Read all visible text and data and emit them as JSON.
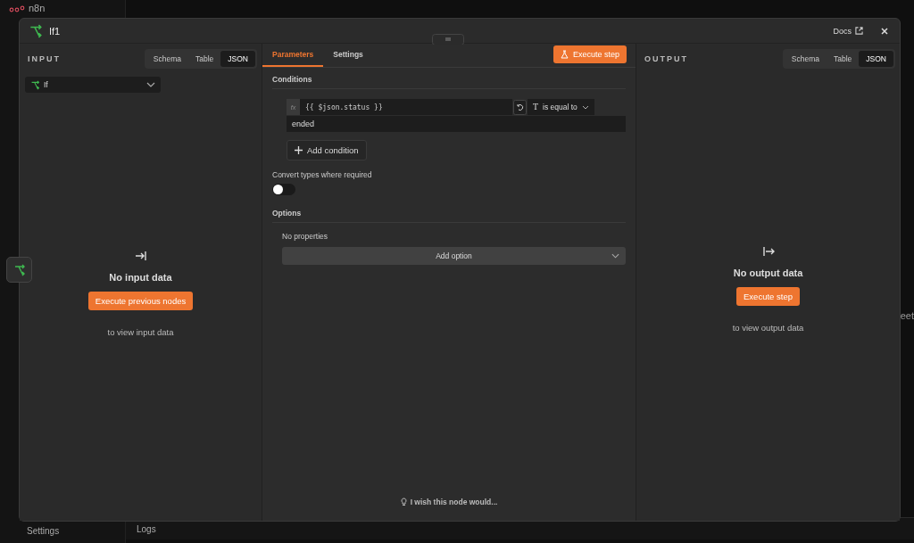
{
  "app": {
    "logo": "n8n",
    "sidebar_settings": "Settings",
    "logs": "Logs",
    "canvas_fragment": "eet"
  },
  "modal": {
    "title": "If1",
    "docs": "Docs"
  },
  "input": {
    "heading": "INPUT",
    "views": [
      {
        "label": "Schema",
        "selected": false
      },
      {
        "label": "Table",
        "selected": false
      },
      {
        "label": "JSON",
        "selected": true
      }
    ],
    "node_select": "If",
    "empty_title": "No input data",
    "button": "Execute previous nodes",
    "hint": "to view input data"
  },
  "tabs": [
    {
      "label": "Parameters",
      "selected": true
    },
    {
      "label": "Settings",
      "selected": false
    }
  ],
  "execute_button": "Execute step",
  "conditions": {
    "label": "Conditions",
    "fx_badge": "fx",
    "left_value": "{{ $json.status }}",
    "type_glyph": "T",
    "operator": "is equal to",
    "right_value": "ended",
    "add_button": "Add condition"
  },
  "convert_types": {
    "label": "Convert types where required",
    "on": false
  },
  "options": {
    "label": "Options",
    "empty": "No properties",
    "add_button": "Add option"
  },
  "feedback": "I wish this node would...",
  "output": {
    "heading": "OUTPUT",
    "views": [
      {
        "label": "Schema",
        "selected": false
      },
      {
        "label": "Table",
        "selected": false
      },
      {
        "label": "JSON",
        "selected": true
      }
    ],
    "empty_title": "No output data",
    "button": "Execute step",
    "hint": "to view output data"
  }
}
